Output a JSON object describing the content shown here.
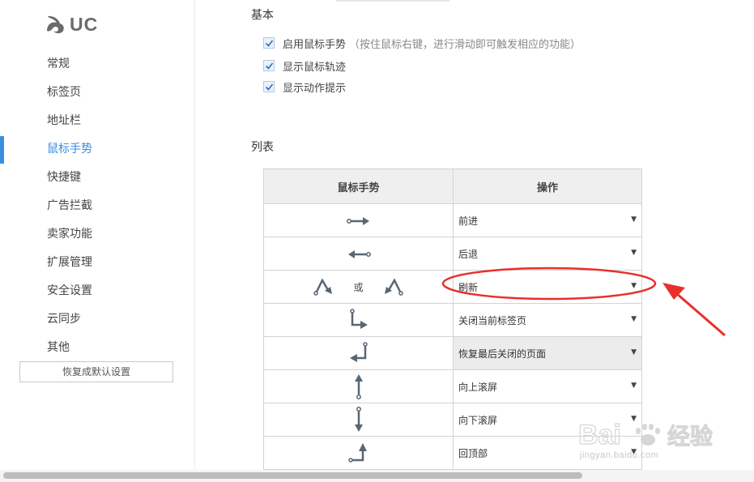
{
  "sidebar": {
    "logo_text": "UC",
    "items": [
      {
        "label": "常规"
      },
      {
        "label": "标签页"
      },
      {
        "label": "地址栏"
      },
      {
        "label": "鼠标手势"
      },
      {
        "label": "快捷键"
      },
      {
        "label": "广告拦截"
      },
      {
        "label": "卖家功能"
      },
      {
        "label": "扩展管理"
      },
      {
        "label": "安全设置"
      },
      {
        "label": "云同步"
      },
      {
        "label": "其他"
      }
    ],
    "active_item": "鼠标手势",
    "restore_label": "恢复成默认设置"
  },
  "basic": {
    "title": "基本",
    "options": [
      {
        "label": "启用鼠标手势",
        "hint": "（按住鼠标右键，进行滑动即可触发相应的功能）",
        "checked": true
      },
      {
        "label": "显示鼠标轨迹",
        "hint": "",
        "checked": true
      },
      {
        "label": "显示动作提示",
        "hint": "",
        "checked": true
      }
    ]
  },
  "list": {
    "title": "列表",
    "headers": {
      "gesture": "鼠标手势",
      "action": "操作"
    },
    "or_label": "或",
    "rows": [
      {
        "gesture_icon": "arrow-right-icon",
        "action": "前进"
      },
      {
        "gesture_icon": "arrow-left-icon",
        "action": "后退"
      },
      {
        "gesture_icon": "up-down-gesture-icon",
        "action": "刷新"
      },
      {
        "gesture_icon": "down-right-gesture-icon",
        "action": "关闭当前标签页"
      },
      {
        "gesture_icon": "up-left-gesture-icon",
        "action": "恢复最后关闭的页面"
      },
      {
        "gesture_icon": "arrow-up-icon",
        "action": "向上滚屏"
      },
      {
        "gesture_icon": "arrow-down-icon",
        "action": "向下滚屏"
      },
      {
        "gesture_icon": "left-up-gesture-icon",
        "action": "回顶部"
      }
    ]
  },
  "watermark": {
    "brand": "Bai经验",
    "url": "jingyan.baidu.com"
  },
  "colors": {
    "accent": "#3b8fe0",
    "annotation": "#e8302a",
    "icon": "#5a6673"
  }
}
